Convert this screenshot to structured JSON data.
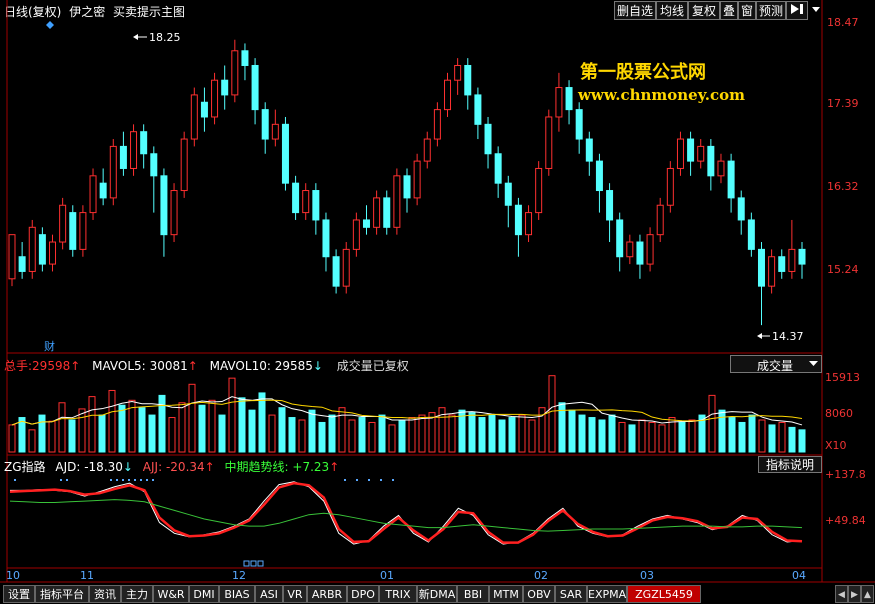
{
  "header": {
    "period": "日线(复权)",
    "indicator_name": "伊之密",
    "indicator_desc": "买卖提示主图",
    "buttons": [
      "删自选",
      "均线",
      "复权",
      "叠",
      "窗",
      "预测"
    ],
    "menu_icon": "arrow-right-bar-icon",
    "dropdown_icon": "chevron-down-icon"
  },
  "watermark": {
    "line1": "第一股票公式网",
    "line2": "www.chnmoney.com"
  },
  "price_panel": {
    "axis_labels": [
      "18.47",
      "17.39",
      "16.32",
      "15.24"
    ],
    "high_label": "18.25",
    "low_label": "14.37",
    "fin_marker": "财"
  },
  "volume_panel": {
    "label_total": "总手:",
    "total_value": "29598",
    "label_mavol5": "MAVOL5:",
    "mavol5_value": "30081",
    "label_mavol10": "MAVOL10:",
    "mavol10_value": "29585",
    "restored_note": "成交量已复权",
    "selector_label": "成交量",
    "axis_labels": [
      "15913",
      "8060",
      "X10"
    ]
  },
  "indicator_panel": {
    "name": "ZG指路",
    "ajd_label": "AJD:",
    "ajd_value": "-18.30",
    "ajj_label": "AJJ:",
    "ajj_value": "-20.34",
    "mid_label": "中期趋势线:",
    "mid_value": "+7.23",
    "help_button": "指标说明",
    "axis_labels": [
      "+137.8",
      "+49.84"
    ]
  },
  "x_axis": {
    "labels": [
      "10",
      "11",
      "12",
      "01",
      "02",
      "03",
      "04"
    ]
  },
  "bottom_tabs": [
    "设置",
    "指标平台",
    "资讯",
    "主力",
    "W&R",
    "DMI",
    "BIAS",
    "ASI",
    "VR",
    "ARBR",
    "DPO",
    "TRIX",
    "新DMA",
    "BBI",
    "MTM",
    "OBV",
    "SAR",
    "EXPMA",
    "ZGZL5459"
  ],
  "active_tab": "ZGZL5459",
  "colors": {
    "up": "#ff3030",
    "down": "#54ffff",
    "white_line": "#ffffff",
    "yellow": "#ffd700",
    "green_line": "#39c239",
    "frame": "#a00000",
    "ajj_label": "#ff5050",
    "mid_label": "#39ff39"
  },
  "chart_data": {
    "type": "candlestick",
    "ylim": [
      14.1,
      18.6
    ],
    "high_marker": 18.25,
    "low_marker": 14.37,
    "x_axis_months": [
      "10",
      "11",
      "12",
      "01",
      "02",
      "03",
      "04"
    ],
    "ohlc": [
      [
        15.0,
        15.6,
        15.5,
        14.9
      ],
      [
        15.3,
        15.1,
        15.5,
        15.0
      ],
      [
        15.1,
        15.7,
        15.8,
        15.0
      ],
      [
        15.6,
        15.2,
        15.7,
        15.1
      ],
      [
        15.2,
        15.5,
        15.6,
        15.1
      ],
      [
        15.5,
        16.0,
        16.1,
        15.4
      ],
      [
        15.9,
        15.4,
        16.0,
        15.3
      ],
      [
        15.4,
        15.9,
        16.0,
        15.3
      ],
      [
        15.9,
        16.4,
        16.5,
        15.8
      ],
      [
        16.3,
        16.1,
        16.5,
        16.0
      ],
      [
        16.1,
        16.8,
        16.9,
        16.0
      ],
      [
        16.8,
        16.5,
        17.0,
        16.4
      ],
      [
        16.5,
        17.0,
        17.1,
        16.4
      ],
      [
        17.0,
        16.7,
        17.1,
        16.5
      ],
      [
        16.7,
        16.4,
        16.8,
        15.9
      ],
      [
        16.4,
        15.6,
        16.5,
        15.3
      ],
      [
        15.6,
        16.2,
        16.3,
        15.5
      ],
      [
        16.2,
        16.9,
        17.0,
        16.1
      ],
      [
        16.9,
        17.5,
        17.6,
        16.8
      ],
      [
        17.4,
        17.2,
        17.6,
        17.0
      ],
      [
        17.2,
        17.7,
        17.8,
        17.1
      ],
      [
        17.7,
        17.5,
        17.9,
        17.3
      ],
      [
        17.5,
        18.1,
        18.25,
        17.4
      ],
      [
        18.1,
        17.9,
        18.2,
        17.7
      ],
      [
        17.9,
        17.3,
        18.0,
        17.1
      ],
      [
        17.3,
        16.9,
        17.4,
        16.7
      ],
      [
        16.9,
        17.1,
        17.3,
        16.8
      ],
      [
        17.1,
        16.3,
        17.2,
        16.2
      ],
      [
        16.3,
        15.9,
        16.4,
        15.8
      ],
      [
        15.9,
        16.2,
        16.3,
        15.8
      ],
      [
        16.2,
        15.8,
        16.3,
        15.6
      ],
      [
        15.8,
        15.3,
        15.9,
        15.1
      ],
      [
        15.3,
        14.9,
        15.4,
        14.8
      ],
      [
        14.9,
        15.4,
        15.5,
        14.8
      ],
      [
        15.4,
        15.8,
        15.9,
        15.3
      ],
      [
        15.8,
        15.7,
        16.0,
        15.6
      ],
      [
        15.7,
        16.1,
        16.2,
        15.6
      ],
      [
        16.1,
        15.7,
        16.2,
        15.6
      ],
      [
        15.7,
        16.4,
        16.5,
        15.6
      ],
      [
        16.4,
        16.1,
        16.5,
        15.9
      ],
      [
        16.1,
        16.6,
        16.7,
        16.0
      ],
      [
        16.6,
        16.9,
        17.0,
        16.5
      ],
      [
        16.9,
        17.3,
        17.4,
        16.8
      ],
      [
        17.3,
        17.7,
        17.8,
        17.2
      ],
      [
        17.7,
        17.9,
        18.0,
        17.5
      ],
      [
        17.9,
        17.5,
        18.0,
        17.3
      ],
      [
        17.5,
        17.1,
        17.6,
        16.9
      ],
      [
        17.1,
        16.7,
        17.2,
        16.5
      ],
      [
        16.7,
        16.3,
        16.8,
        16.1
      ],
      [
        16.3,
        16.0,
        16.4,
        15.7
      ],
      [
        16.0,
        15.6,
        16.1,
        15.3
      ],
      [
        15.6,
        15.9,
        16.0,
        15.5
      ],
      [
        15.9,
        16.5,
        16.6,
        15.8
      ],
      [
        16.5,
        17.2,
        17.3,
        16.4
      ],
      [
        17.2,
        17.6,
        17.8,
        17.0
      ],
      [
        17.6,
        17.3,
        17.7,
        17.1
      ],
      [
        17.3,
        16.9,
        17.4,
        16.7
      ],
      [
        16.9,
        16.6,
        17.0,
        16.4
      ],
      [
        16.6,
        16.2,
        16.7,
        15.9
      ],
      [
        16.2,
        15.8,
        16.3,
        15.5
      ],
      [
        15.8,
        15.3,
        15.9,
        15.1
      ],
      [
        15.3,
        15.5,
        15.6,
        15.2
      ],
      [
        15.5,
        15.2,
        15.6,
        15.0
      ],
      [
        15.2,
        15.6,
        15.7,
        15.1
      ],
      [
        15.6,
        16.0,
        16.1,
        15.5
      ],
      [
        16.0,
        16.5,
        16.6,
        15.9
      ],
      [
        16.5,
        16.9,
        17.0,
        16.4
      ],
      [
        16.9,
        16.6,
        17.0,
        16.4
      ],
      [
        16.6,
        16.8,
        16.9,
        16.5
      ],
      [
        16.8,
        16.4,
        16.9,
        16.2
      ],
      [
        16.4,
        16.6,
        16.7,
        16.3
      ],
      [
        16.6,
        16.1,
        16.7,
        15.9
      ],
      [
        16.1,
        15.8,
        16.2,
        15.6
      ],
      [
        15.8,
        15.4,
        15.9,
        15.3
      ],
      [
        15.4,
        14.9,
        15.5,
        14.37
      ],
      [
        14.9,
        15.3,
        15.4,
        14.8
      ],
      [
        15.3,
        15.1,
        15.4,
        15.0
      ],
      [
        15.1,
        15.4,
        15.8,
        15.0
      ],
      [
        15.4,
        15.2,
        15.5,
        15.0
      ]
    ],
    "volume": [
      22,
      28,
      18,
      30,
      25,
      40,
      26,
      35,
      45,
      30,
      50,
      38,
      42,
      36,
      30,
      46,
      28,
      40,
      55,
      38,
      42,
      30,
      60,
      44,
      34,
      48,
      30,
      36,
      28,
      26,
      34,
      24,
      30,
      36,
      26,
      28,
      24,
      30,
      22,
      26,
      28,
      30,
      32,
      36,
      30,
      34,
      32,
      28,
      30,
      26,
      28,
      30,
      26,
      36,
      62,
      40,
      34,
      30,
      28,
      26,
      30,
      24,
      22,
      26,
      24,
      22,
      28,
      24,
      26,
      30,
      46,
      34,
      28,
      24,
      30,
      26,
      22,
      24,
      20,
      18
    ],
    "indicator_series": [
      {
        "name": "AJD",
        "values": [
          120,
          120,
          121,
          120,
          118,
          112,
          118,
          125,
          130,
          118,
          75,
          60,
          55,
          58,
          62,
          70,
          80,
          105,
          128,
          132,
          125,
          105,
          60,
          45,
          50,
          70,
          85,
          60,
          48,
          70,
          95,
          85,
          58,
          45,
          48,
          60,
          80,
          95,
          70,
          60,
          55,
          58,
          70,
          80,
          85,
          80,
          75,
          65,
          70,
          85,
          78,
          58,
          48,
          50
        ]
      },
      {
        "name": "AJJ",
        "values": [
          118,
          119,
          120,
          121,
          119,
          114,
          116,
          122,
          127,
          120,
          82,
          64,
          56,
          57,
          60,
          68,
          78,
          100,
          124,
          130,
          127,
          110,
          66,
          48,
          49,
          66,
          82,
          64,
          50,
          66,
          90,
          88,
          62,
          47,
          47,
          58,
          77,
          92,
          73,
          62,
          56,
          57,
          67,
          78,
          83,
          81,
          77,
          67,
          69,
          82,
          80,
          62,
          50,
          49
        ]
      },
      {
        "name": "中期趋势线",
        "values": [
          105,
          104,
          103,
          103,
          104,
          105,
          106,
          107,
          106,
          104,
          98,
          92,
          86,
          80,
          76,
          72,
          70,
          70,
          74,
          80,
          86,
          88,
          86,
          82,
          78,
          74,
          72,
          70,
          68,
          68,
          70,
          72,
          70,
          68,
          66,
          64,
          63,
          64,
          65,
          66,
          66,
          66,
          67,
          68,
          69,
          70,
          70,
          70,
          69,
          69,
          70,
          70,
          69,
          68
        ]
      }
    ]
  }
}
